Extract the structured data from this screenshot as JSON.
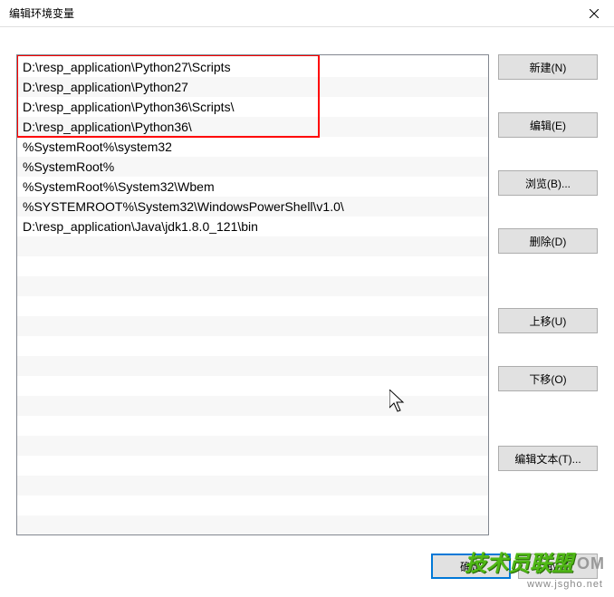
{
  "titlebar": {
    "title": "编辑环境变量"
  },
  "path_entries": [
    "D:\\resp_application\\Python27\\Scripts",
    "D:\\resp_application\\Python27",
    "D:\\resp_application\\Python36\\Scripts\\",
    "D:\\resp_application\\Python36\\",
    "%SystemRoot%\\system32",
    "%SystemRoot%",
    "%SystemRoot%\\System32\\Wbem",
    "%SYSTEMROOT%\\System32\\WindowsPowerShell\\v1.0\\",
    "D:\\resp_application\\Java\\jdk1.8.0_121\\bin"
  ],
  "buttons": {
    "new": "新建(N)",
    "edit": "编辑(E)",
    "browse": "浏览(B)...",
    "delete": "删除(D)",
    "move_up": "上移(U)",
    "move_down": "下移(O)",
    "edit_text": "编辑文本(T)...",
    "ok": "确定",
    "cancel": "取消"
  },
  "watermark": {
    "main": "技术员联盟",
    "suffix": "OM",
    "sub": "www.jsgho.net"
  }
}
